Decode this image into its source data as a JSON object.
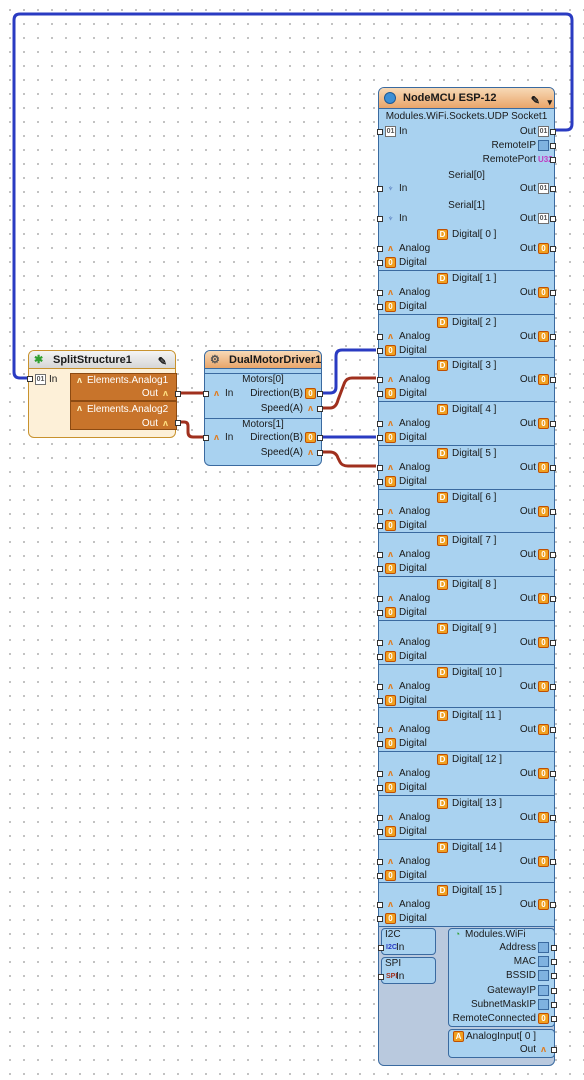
{
  "split": {
    "title": "SplitStructure1",
    "in_label": "In",
    "elements": [
      {
        "label": "Elements.Analog1",
        "out_label": "Out"
      },
      {
        "label": "Elements.Analog2",
        "out_label": "Out"
      }
    ]
  },
  "dual": {
    "title": "DualMotorDriver1",
    "motors": [
      {
        "label": "Motors[0]",
        "in_label": "In",
        "direction_label": "Direction(B)",
        "speed_label": "Speed(A)"
      },
      {
        "label": "Motors[1]",
        "in_label": "In",
        "direction_label": "Direction(B)",
        "speed_label": "Speed(A)"
      }
    ]
  },
  "node": {
    "title": "NodeMCU ESP-12",
    "udp": {
      "label": "Modules.WiFi.Sockets.UDP Socket1",
      "in_label": "In",
      "out_label": "Out",
      "remote_ip_label": "RemoteIP",
      "remote_port_label": "RemotePort"
    },
    "serial": [
      {
        "label": "Serial[0]",
        "in_label": "In",
        "out_label": "Out"
      },
      {
        "label": "Serial[1]",
        "in_label": "In",
        "out_label": "Out"
      }
    ],
    "digital": [
      {
        "label": "Digital[ 0 ]",
        "analog_label": "Analog",
        "digital_label": "Digital",
        "out_label": "Out"
      },
      {
        "label": "Digital[ 1 ]",
        "analog_label": "Analog",
        "digital_label": "Digital",
        "out_label": "Out"
      },
      {
        "label": "Digital[ 2 ]",
        "analog_label": "Analog",
        "digital_label": "Digital",
        "out_label": "Out"
      },
      {
        "label": "Digital[ 3 ]",
        "analog_label": "Analog",
        "digital_label": "Digital",
        "out_label": "Out"
      },
      {
        "label": "Digital[ 4 ]",
        "analog_label": "Analog",
        "digital_label": "Digital",
        "out_label": "Out"
      },
      {
        "label": "Digital[ 5 ]",
        "analog_label": "Analog",
        "digital_label": "Digital",
        "out_label": "Out"
      },
      {
        "label": "Digital[ 6 ]",
        "analog_label": "Analog",
        "digital_label": "Digital",
        "out_label": "Out"
      },
      {
        "label": "Digital[ 7 ]",
        "analog_label": "Analog",
        "digital_label": "Digital",
        "out_label": "Out"
      },
      {
        "label": "Digital[ 8 ]",
        "analog_label": "Analog",
        "digital_label": "Digital",
        "out_label": "Out"
      },
      {
        "label": "Digital[ 9 ]",
        "analog_label": "Analog",
        "digital_label": "Digital",
        "out_label": "Out"
      },
      {
        "label": "Digital[ 10 ]",
        "analog_label": "Analog",
        "digital_label": "Digital",
        "out_label": "Out"
      },
      {
        "label": "Digital[ 11 ]",
        "analog_label": "Analog",
        "digital_label": "Digital",
        "out_label": "Out"
      },
      {
        "label": "Digital[ 12 ]",
        "analog_label": "Analog",
        "digital_label": "Digital",
        "out_label": "Out"
      },
      {
        "label": "Digital[ 13 ]",
        "analog_label": "Analog",
        "digital_label": "Digital",
        "out_label": "Out"
      },
      {
        "label": "Digital[ 14 ]",
        "analog_label": "Analog",
        "digital_label": "Digital",
        "out_label": "Out"
      },
      {
        "label": "Digital[ 15 ]",
        "analog_label": "Analog",
        "digital_label": "Digital",
        "out_label": "Out"
      }
    ],
    "i2c": {
      "label": "I2C",
      "in_label": "In"
    },
    "spi": {
      "label": "SPI",
      "in_label": "In"
    },
    "wifi": {
      "label": "Modules.WiFi",
      "outputs": [
        "Address",
        "MAC",
        "BSSID",
        "GatewayIP",
        "SubnetMaskIP",
        "RemoteConnected"
      ]
    },
    "analog_input": {
      "label": "AnalogInput[ 0 ]",
      "out_label": "Out"
    }
  },
  "colors": {
    "wire_blue": "#2a3bc2",
    "wire_red": "#a0301e",
    "panel_blue": "#a9d2f0",
    "panel_border": "#3a6aa0",
    "orange": "#c8742b"
  },
  "icons": {
    "title_split": "split-structure-icon",
    "title_dual": "motor-driver-icon",
    "title_node": "nodemcu-icon",
    "tool": "wrench-icon"
  }
}
